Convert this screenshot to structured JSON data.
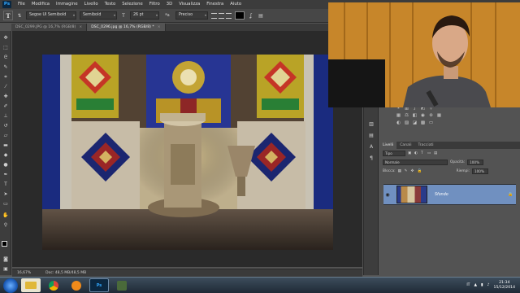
{
  "app": {
    "logo": "Ps"
  },
  "menu": [
    "File",
    "Modifica",
    "Immagine",
    "Livello",
    "Testo",
    "Selezione",
    "Filtro",
    "3D",
    "Visualizza",
    "Finestra",
    "Aiuto"
  ],
  "options": {
    "tool_glyph": "T",
    "font_family": "Segoe UI Semibold",
    "font_style": "Semibold",
    "font_size": "26 pt",
    "antialias_symbol": "ªa",
    "antialias": "Preciso"
  },
  "tabs": [
    {
      "label": "DSC_0299.JPG @ 16,7% (RGB/8)",
      "close": "×"
    },
    {
      "label": "DSC_0296.jpg @ 16,7% (RGB/8) *",
      "close": "×"
    }
  ],
  "status": {
    "zoom": "16,67%",
    "doc": "Doc: 48,5 MB/48,5 MB"
  },
  "panels": {
    "adjustments_title": "Aggiungi una regolazione",
    "layers_tabs": [
      "Livelli",
      "Canali",
      "Tracciati"
    ],
    "kind_filter": "Tipo",
    "blend_mode": "Normale",
    "opacity_label": "Opacità:",
    "opacity_value": "100%",
    "lock_label": "Blocca:",
    "fill_label": "Riempi:",
    "fill_value": "100%",
    "layer_name": "Sfondo"
  },
  "taskbar": {
    "ps_label": "Ps",
    "language": "IT",
    "time": "21:34",
    "date": "15/12/2014"
  },
  "icons": {
    "toolbar": [
      "move-icon",
      "marquee-icon",
      "lasso-icon",
      "quick-select-icon",
      "crop-icon",
      "eyedropper-icon",
      "healing-icon",
      "brush-icon",
      "clone-stamp-icon",
      "history-brush-icon",
      "eraser-icon",
      "gradient-icon",
      "blur-icon",
      "dodge-icon",
      "pen-icon",
      "type-icon",
      "path-select-icon",
      "shape-icon",
      "hand-icon",
      "zoom-icon"
    ]
  },
  "colors": {
    "accent": "#31a8ff",
    "layer_selected": "#7090c0"
  }
}
